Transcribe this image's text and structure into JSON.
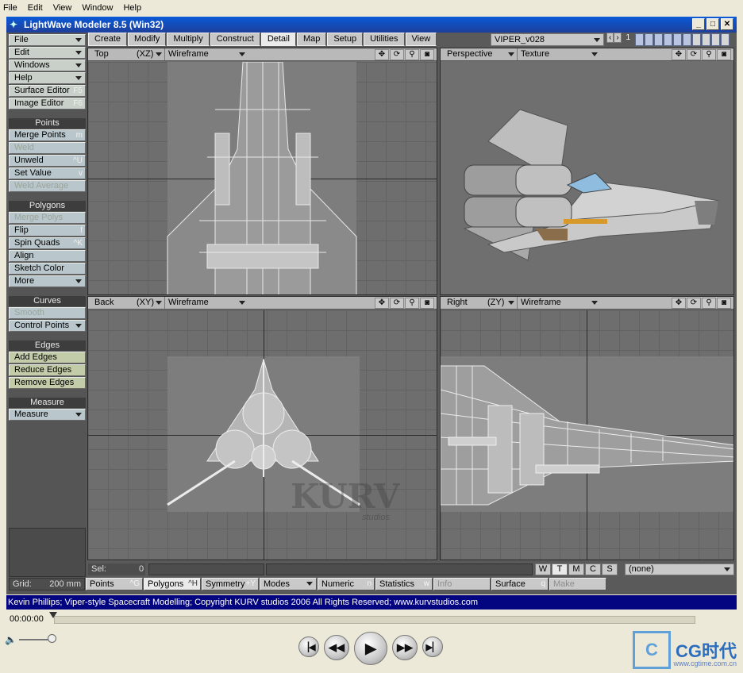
{
  "os_menu": [
    "File",
    "Edit",
    "View",
    "Window",
    "Help"
  ],
  "window": {
    "title": "LightWave Modeler 8.5 (Win32)",
    "min": "_",
    "max": "□",
    "close": "✕"
  },
  "sidebar": {
    "top": [
      {
        "label": "File",
        "dropdown": true
      },
      {
        "label": "Edit",
        "dropdown": true
      },
      {
        "label": "Windows",
        "dropdown": true
      },
      {
        "label": "Help",
        "dropdown": true
      },
      {
        "label": "Surface Editor",
        "key": "F5"
      },
      {
        "label": "Image Editor",
        "key": "F6"
      }
    ],
    "points_head": "Points",
    "points": [
      {
        "label": "Merge Points",
        "key": "m"
      },
      {
        "label": "Weld",
        "dim": true
      },
      {
        "label": "Unweld",
        "key": "^U"
      },
      {
        "label": "Set Value",
        "key": "v"
      },
      {
        "label": "Weld Average",
        "dim": true
      }
    ],
    "polygons_head": "Polygons",
    "polygons": [
      {
        "label": "Merge Polys",
        "dim": true
      },
      {
        "label": "Flip",
        "key": "f"
      },
      {
        "label": "Spin Quads",
        "key": "^K"
      },
      {
        "label": "Align"
      },
      {
        "label": "Sketch Color"
      },
      {
        "label": "More",
        "dropdown": true
      }
    ],
    "curves_head": "Curves",
    "curves": [
      {
        "label": "Smooth",
        "dim": true
      },
      {
        "label": "Control Points",
        "dropdown": true
      }
    ],
    "edges_head": "Edges",
    "edges": [
      {
        "label": "Add Edges"
      },
      {
        "label": "Reduce Edges"
      },
      {
        "label": "Remove Edges"
      }
    ],
    "measure_head": "Measure",
    "measure": [
      {
        "label": "Measure",
        "dropdown": true
      }
    ]
  },
  "tabs": [
    "Create",
    "Modify",
    "Multiply",
    "Construct",
    "Detail",
    "Map",
    "Setup",
    "Utilities",
    "View"
  ],
  "active_tab": "Detail",
  "object": {
    "name": "VIPER_v028",
    "layer_num": "1"
  },
  "viewports": [
    {
      "view": "Top",
      "axis": "(XZ)",
      "mode": "Wireframe"
    },
    {
      "view": "Perspective",
      "axis": "",
      "mode": "Texture"
    },
    {
      "view": "Back",
      "axis": "(XY)",
      "mode": "Wireframe"
    },
    {
      "view": "Right",
      "axis": "(ZY)",
      "mode": "Wireframe"
    }
  ],
  "status": {
    "sel_label": "Sel:",
    "sel_value": "0",
    "surface": "(none)",
    "wtmcs": [
      "W",
      "T",
      "M",
      "C",
      "S"
    ]
  },
  "modebar": {
    "grid_label": "Grid:",
    "grid_value": "200 mm",
    "points": "Points",
    "points_key": "^G",
    "polygons": "Polygons",
    "polygons_key": "^H",
    "symmetry": "Symmetry",
    "symmetry_key": "+Y",
    "modes": "Modes",
    "numeric": "Numeric",
    "numeric_key": "n",
    "statistics": "Statistics",
    "statistics_key": "w",
    "info": "Info",
    "surface": "Surface",
    "surface_key": "q",
    "make": "Make"
  },
  "info_line": "Kevin Phillips; Viper-style Spacecraft Modelling;  Copyright KURV studios 2006 All Rights Reserved;  www.kurvstudios.com",
  "player": {
    "time": "00:00:00",
    "progress": 0.0,
    "brand": "CG时代",
    "brand_url": "www.cgtime.com.cn"
  },
  "watermark": {
    "name": "KURV",
    "sub": "studios"
  }
}
